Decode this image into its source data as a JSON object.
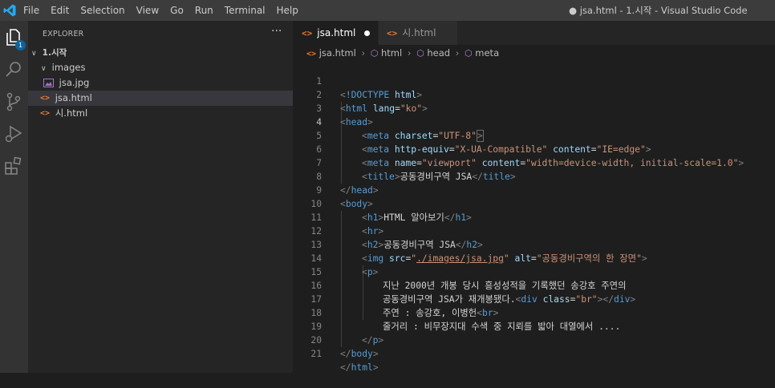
{
  "titlebar": {
    "menu": [
      "File",
      "Edit",
      "Selection",
      "View",
      "Go",
      "Run",
      "Terminal",
      "Help"
    ],
    "window_title": "● jsa.html - 1.시작 - Visual Studio Code"
  },
  "activity_bar": {
    "items": [
      "explorer-icon",
      "search-icon",
      "source-control-icon",
      "run-debug-icon",
      "extensions-icon"
    ],
    "explorer_badge": "1"
  },
  "explorer": {
    "title": "EXPLORER",
    "more": "···",
    "folder": "1.시작",
    "subfolder": "images",
    "files": {
      "image": "jsa.jpg",
      "jsa": "jsa.html",
      "si": "시.html"
    }
  },
  "tabs": [
    {
      "label": "jsa.html",
      "modified": true,
      "active": true
    },
    {
      "label": "시.html",
      "modified": false,
      "active": false
    }
  ],
  "breadcrumb": {
    "file": "jsa.html",
    "items": [
      "html",
      "head",
      "meta"
    ]
  },
  "editor": {
    "line_numbers": [
      "1",
      "2",
      "3",
      "4",
      "5",
      "6",
      "7",
      "8",
      "9",
      "10",
      "11",
      "12",
      "13",
      "14",
      "15",
      "16",
      "17",
      "18",
      "19",
      "20",
      "21"
    ],
    "current_line": "4",
    "text": {
      "t1": "공동경비구역 JSA",
      "h1": "HTML 알아보기",
      "h2": "공동경비구역 JSA",
      "alt": "\"공동경비구역의 한 장면\"",
      "p1": "지난 2000년 개봉 당시 흥성성적을 기록했던 송강호 주연의",
      "p2": "공동경비구역 JSA가 재개봉됐다.",
      "p3": "주연 : 송강호, 이병헌",
      "p4": "줄거리 : 비무장지대 수색 중 지뢰를 밟아 대열에서 ...."
    }
  },
  "colors": {
    "accent": "#0e639c",
    "html_icon": "#e37933",
    "keyword": "#569cd6",
    "attribute": "#9cdcfe",
    "string": "#ce9178"
  }
}
